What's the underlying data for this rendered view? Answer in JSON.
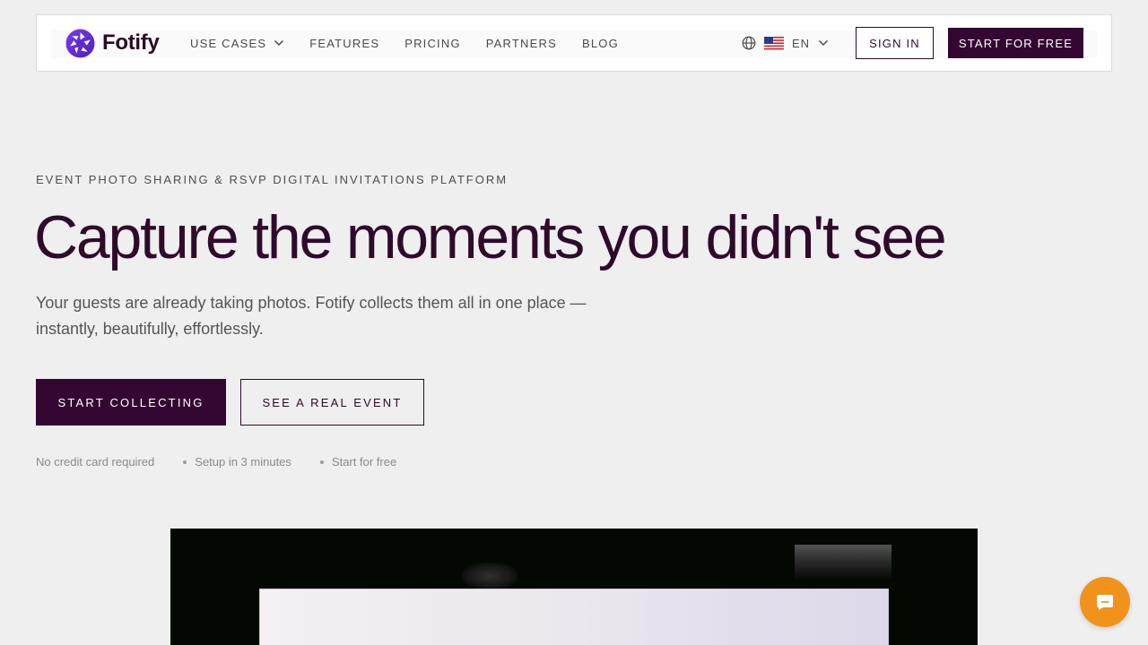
{
  "brand": {
    "name": "Fotify",
    "logo_icon": "aperture-icon",
    "color": "#340733"
  },
  "nav": {
    "links": [
      {
        "label": "USE CASES",
        "has_dropdown": true
      },
      {
        "label": "FEATURES"
      },
      {
        "label": "PRICING"
      },
      {
        "label": "PARTNERS"
      },
      {
        "label": "BLOG"
      }
    ],
    "language": {
      "icon": "globe-icon",
      "flag": "us-flag-icon",
      "code": "EN"
    },
    "sign_in": "SIGN IN",
    "start_free": "START FOR FREE"
  },
  "hero": {
    "eyebrow": "EVENT PHOTO SHARING & RSVP DIGITAL INVITATIONS PLATFORM",
    "title": "Capture the moments you didn't see",
    "subtitle": "Your guests are already taking photos. Fotify collects them all in one place — instantly, beautifully, effortlessly.",
    "cta_primary": "START COLLECTING",
    "cta_secondary": "SEE A REAL EVENT",
    "perks": [
      "No credit card required",
      "Setup in 3 minutes",
      "Start for free"
    ]
  },
  "chat": {
    "icon": "chat-icon",
    "color": "#f0921c"
  },
  "colors": {
    "background": "#efefef",
    "accent": "#340733",
    "chat": "#f0921c"
  }
}
